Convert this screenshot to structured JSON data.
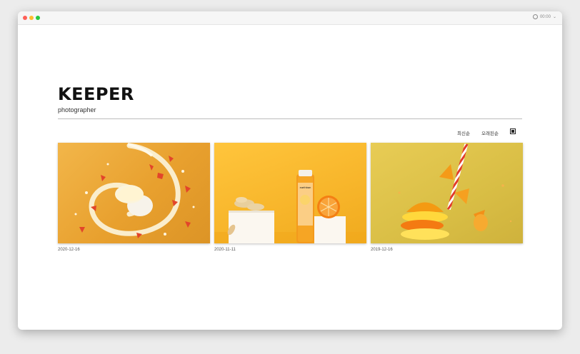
{
  "window": {
    "clock_text": "00:00"
  },
  "header": {
    "brand": "KEEPER",
    "subtitle": "photographer"
  },
  "toolbar": {
    "sort_latest": "최신순",
    "sort_popular": "오래된순"
  },
  "gallery": [
    {
      "date": "2020-12-16"
    },
    {
      "date": "2020-11-11"
    },
    {
      "date": "2019-12-16"
    }
  ],
  "product": {
    "bottle_label": "earthban"
  }
}
